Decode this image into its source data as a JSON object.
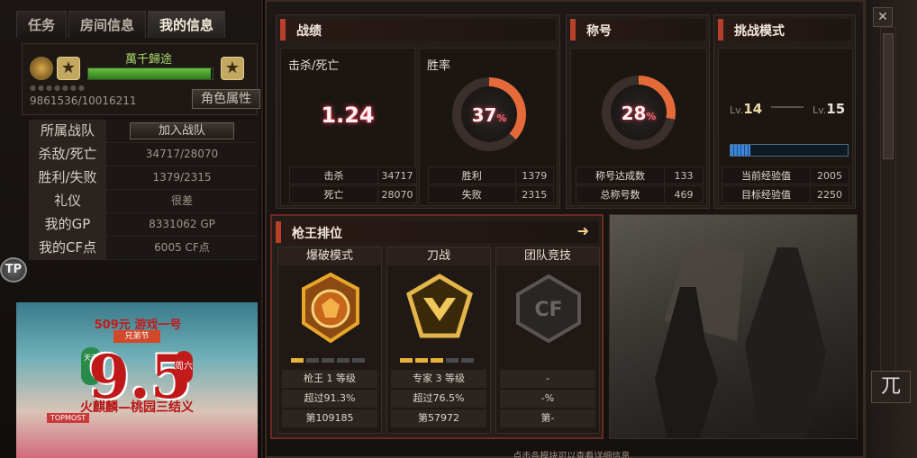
{
  "tabs": [
    {
      "label": "任务"
    },
    {
      "label": "房间信息"
    },
    {
      "label": "我的信息"
    }
  ],
  "profile": {
    "name": "萬千歸途",
    "exp_text": "9861536/10016211",
    "exp_progress": 0.985,
    "role_attr_label": "角色属性"
  },
  "info": {
    "rows": [
      {
        "key": "所属战队",
        "value": "加入战队"
      },
      {
        "key": "杀敌/死亡",
        "value": "34717/28070"
      },
      {
        "key": "胜利/失败",
        "value": "1379/2315"
      },
      {
        "key": "礼仪",
        "value": "很差"
      },
      {
        "key": "我的GP",
        "value": "8331062 GP"
      },
      {
        "key": "我的CF点",
        "value": "6005 CF点"
      }
    ]
  },
  "tp_logo": "TP",
  "banner": {
    "top": "509元 游戏一号",
    "sub": "兄弟节",
    "big": "9.5",
    "left": "天天",
    "right": "周六",
    "line": "火麒麟—桃园三结义",
    "small": "TOPMOST"
  },
  "record": {
    "title": "战绩",
    "kd_label": "击杀/死亡",
    "kd_value": "1.24",
    "winrate_label": "胜率",
    "winrate_value": "37",
    "winrate_pct": 37,
    "rows": [
      {
        "k": "击杀",
        "v": "34717"
      },
      {
        "k": "死亡",
        "v": "28070"
      },
      {
        "k": "胜利",
        "v": "1379"
      },
      {
        "k": "失败",
        "v": "2315"
      }
    ]
  },
  "title_card": {
    "title": "称号",
    "pct_value": "28",
    "pct": 28,
    "rows": [
      {
        "k": "称号达成数",
        "v": "133"
      },
      {
        "k": "总称号数",
        "v": "469"
      }
    ]
  },
  "challenge": {
    "title": "挑战模式",
    "lv_from": "14",
    "lv_to": "15",
    "lv_prefix": "Lv.",
    "progress": 0.17,
    "rows": [
      {
        "k": "当前经验值",
        "v": "2005"
      },
      {
        "k": "目标经验值",
        "v": "2250"
      }
    ]
  },
  "ranking": {
    "title": "枪王排位",
    "columns": [
      {
        "name": "爆破模式",
        "stars_on": 1,
        "rank": "枪王 1 等级",
        "beat": "超过91.3%",
        "pos": "第109185",
        "medal_color": "#e8a62a"
      },
      {
        "name": "刀战",
        "stars_on": 3,
        "rank": "专家 3 等级",
        "beat": "超过76.5%",
        "pos": "第57972",
        "medal_color": "#e3b54a"
      },
      {
        "name": "团队竞技",
        "stars_on": 0,
        "rank": "-",
        "beat": "-%",
        "pos": "第-",
        "medal_color": "#6a6a6a"
      }
    ]
  },
  "hint": "点击各模块可以查看详细信息.",
  "strip_icon": "兀",
  "colors": {
    "accent": "#b7402a",
    "glow": "#e73a4d",
    "ring": "#e56a3a"
  }
}
